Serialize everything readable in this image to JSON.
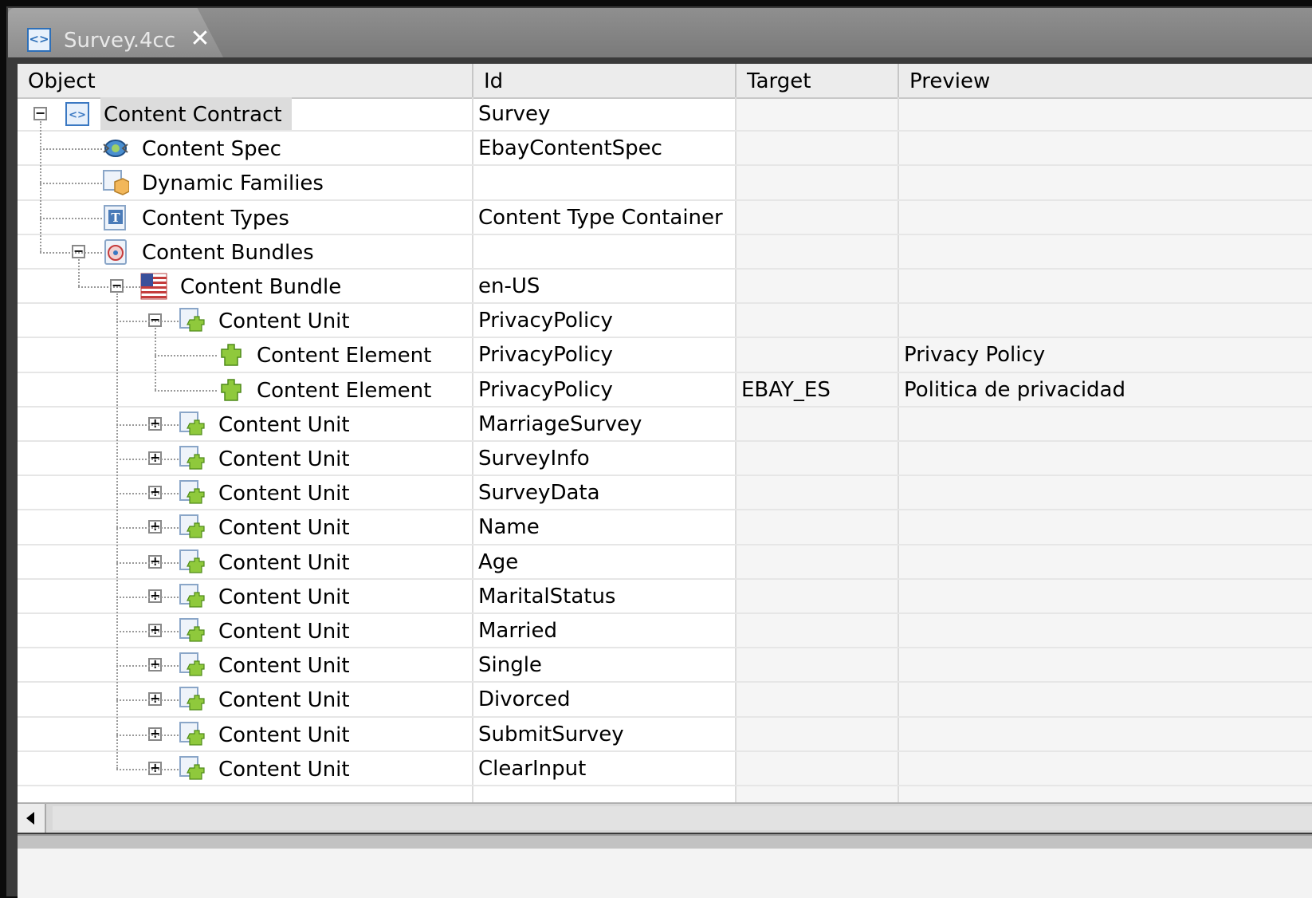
{
  "tab": {
    "title": "Survey.4cc",
    "icon": "contract-icon",
    "close_glyph": "✕"
  },
  "table": {
    "columns": [
      {
        "label": "Object"
      },
      {
        "label": "Id"
      },
      {
        "label": "Target"
      },
      {
        "label": "Preview"
      }
    ],
    "rows": [
      {
        "label": "Content Contract",
        "id": "Survey",
        "target": "",
        "preview": "",
        "depth": 0,
        "toggle": "-",
        "icon": "contract-icon",
        "selected": true
      },
      {
        "label": "Content Spec",
        "id": "EbayContentSpec",
        "target": "",
        "preview": "",
        "depth": 1,
        "toggle": "",
        "icon": "spec-icon"
      },
      {
        "label": "Dynamic Families",
        "id": "",
        "target": "",
        "preview": "",
        "depth": 1,
        "toggle": "",
        "icon": "families-icon"
      },
      {
        "label": "Content Types",
        "id": "Content Type Container",
        "target": "",
        "preview": "",
        "depth": 1,
        "toggle": "",
        "icon": "types-icon"
      },
      {
        "label": "Content Bundles",
        "id": "",
        "target": "",
        "preview": "",
        "depth": 1,
        "toggle": "-",
        "icon": "bundles-icon"
      },
      {
        "label": "Content Bundle",
        "id": "en-US",
        "target": "",
        "preview": "",
        "depth": 2,
        "toggle": "-",
        "icon": "us-flag-icon"
      },
      {
        "label": "Content Unit",
        "id": "PrivacyPolicy",
        "target": "",
        "preview": "",
        "depth": 3,
        "toggle": "-",
        "icon": "unit-icon"
      },
      {
        "label": "Content Element",
        "id": "PrivacyPolicy",
        "target": "",
        "preview": "Privacy Policy",
        "depth": 4,
        "toggle": "",
        "icon": "element-icon"
      },
      {
        "label": "Content Element",
        "id": "PrivacyPolicy",
        "target": "EBAY_ES",
        "preview": "Politica de privacidad",
        "depth": 4,
        "toggle": "",
        "icon": "element-icon"
      },
      {
        "label": "Content Unit",
        "id": "MarriageSurvey",
        "target": "",
        "preview": "",
        "depth": 3,
        "toggle": "+",
        "icon": "unit-icon"
      },
      {
        "label": "Content Unit",
        "id": "SurveyInfo",
        "target": "",
        "preview": "",
        "depth": 3,
        "toggle": "+",
        "icon": "unit-icon"
      },
      {
        "label": "Content Unit",
        "id": "SurveyData",
        "target": "",
        "preview": "",
        "depth": 3,
        "toggle": "+",
        "icon": "unit-icon"
      },
      {
        "label": "Content Unit",
        "id": "Name",
        "target": "",
        "preview": "",
        "depth": 3,
        "toggle": "+",
        "icon": "unit-icon"
      },
      {
        "label": "Content Unit",
        "id": "Age",
        "target": "",
        "preview": "",
        "depth": 3,
        "toggle": "+",
        "icon": "unit-icon"
      },
      {
        "label": "Content Unit",
        "id": "MaritalStatus",
        "target": "",
        "preview": "",
        "depth": 3,
        "toggle": "+",
        "icon": "unit-icon"
      },
      {
        "label": "Content Unit",
        "id": "Married",
        "target": "",
        "preview": "",
        "depth": 3,
        "toggle": "+",
        "icon": "unit-icon"
      },
      {
        "label": "Content Unit",
        "id": "Single",
        "target": "",
        "preview": "",
        "depth": 3,
        "toggle": "+",
        "icon": "unit-icon"
      },
      {
        "label": "Content Unit",
        "id": "Divorced",
        "target": "",
        "preview": "",
        "depth": 3,
        "toggle": "+",
        "icon": "unit-icon"
      },
      {
        "label": "Content Unit",
        "id": "SubmitSurvey",
        "target": "",
        "preview": "",
        "depth": 3,
        "toggle": "+",
        "icon": "unit-icon"
      },
      {
        "label": "Content Unit",
        "id": "ClearInput",
        "target": "",
        "preview": "",
        "depth": 3,
        "toggle": "+",
        "icon": "unit-icon"
      }
    ]
  },
  "scrollbar": {
    "left_arrow": "scroll-left-icon"
  }
}
